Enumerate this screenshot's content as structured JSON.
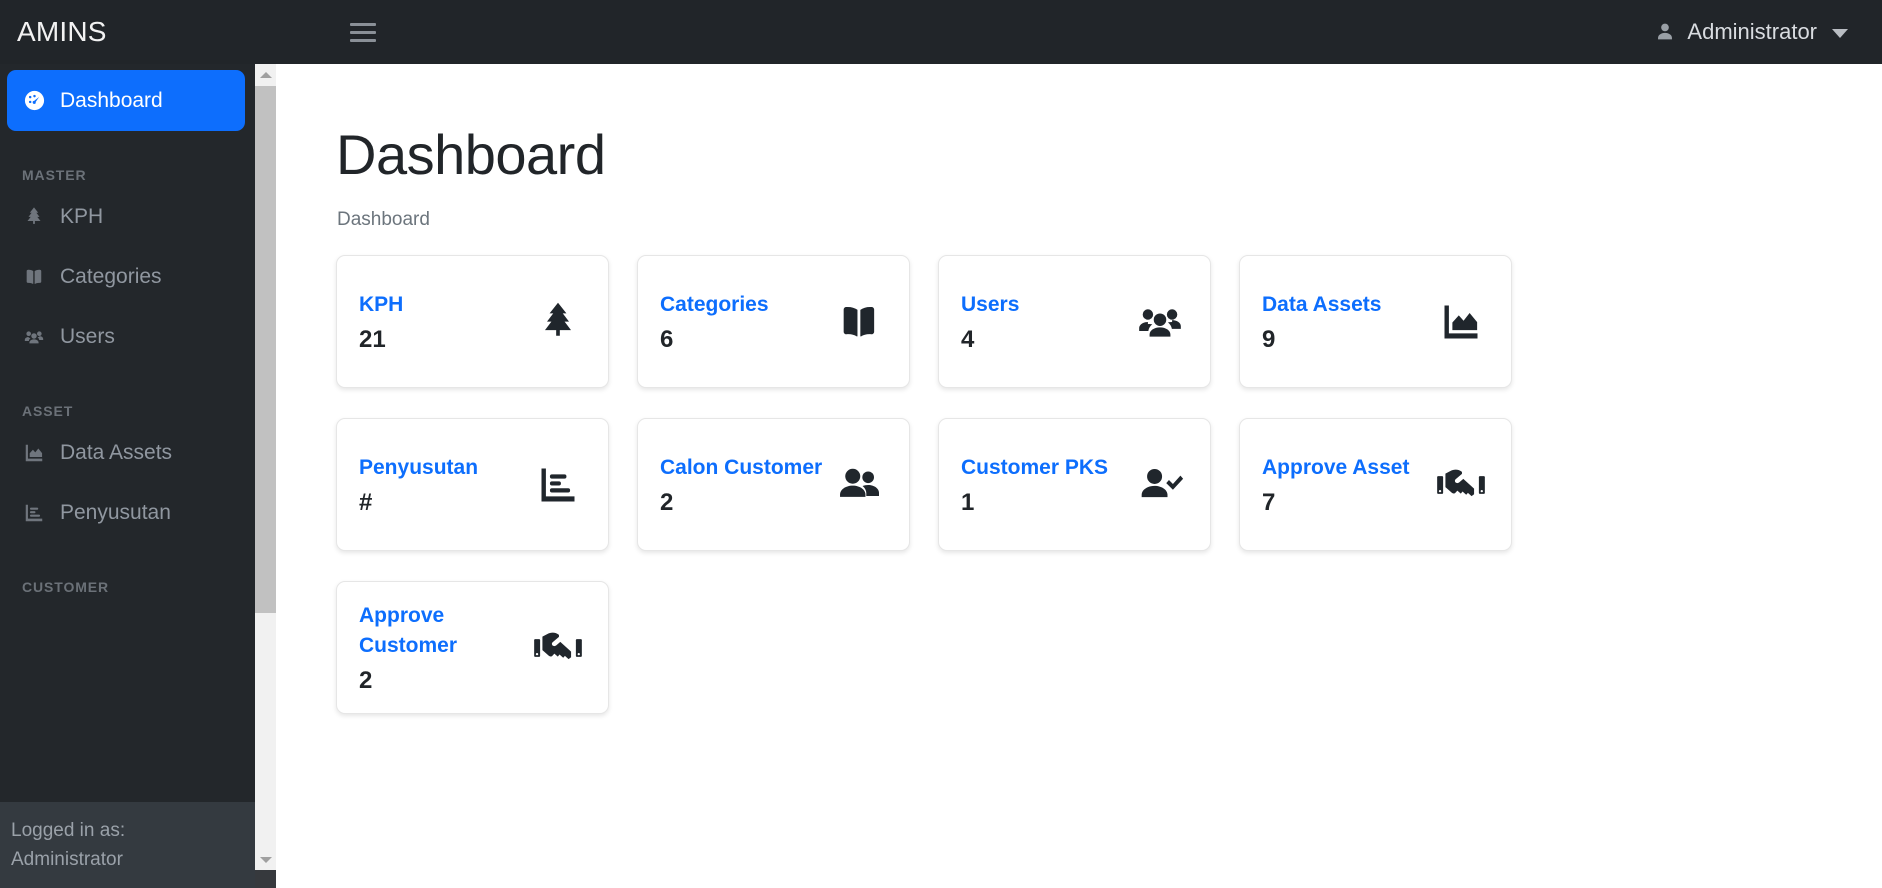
{
  "navbar": {
    "brand": "AMINS",
    "menu_toggle_label": "Toggle navigation",
    "user_name": "Administrator"
  },
  "sidebar": {
    "items": [
      {
        "label": "Dashboard",
        "icon": "dashboard-icon",
        "active": true
      },
      {
        "type": "header",
        "label": "MASTER"
      },
      {
        "label": "KPH",
        "icon": "tree-icon"
      },
      {
        "label": "Categories",
        "icon": "book-open-icon"
      },
      {
        "label": "Users",
        "icon": "users-icon"
      },
      {
        "type": "header",
        "label": "ASSET"
      },
      {
        "label": "Data Assets",
        "icon": "chart-area-icon"
      },
      {
        "label": "Penyusutan",
        "icon": "chart-bar-icon"
      },
      {
        "type": "header",
        "label": "CUSTOMER"
      }
    ],
    "footer": {
      "logged_in_label": "Logged in as:",
      "user_name": "Administrator"
    }
  },
  "main": {
    "title": "Dashboard",
    "breadcrumb": "Dashboard",
    "cards": [
      {
        "label": "KPH",
        "value": "21",
        "icon": "tree-icon"
      },
      {
        "label": "Categories",
        "value": "6",
        "icon": "book-open-icon"
      },
      {
        "label": "Users",
        "value": "4",
        "icon": "users-icon"
      },
      {
        "label": "Data Assets",
        "value": "9",
        "icon": "chart-area-icon"
      },
      {
        "label": "Penyusutan",
        "value": "#",
        "icon": "chart-bar-icon"
      },
      {
        "label": "Calon Customer",
        "value": "2",
        "icon": "user-friends-icon"
      },
      {
        "label": "Customer PKS",
        "value": "1",
        "icon": "user-check-icon"
      },
      {
        "label": "Approve Asset",
        "value": "7",
        "icon": "handshake-icon"
      },
      {
        "label": "Approve Customer",
        "value": "2",
        "icon": "handshake-icon"
      }
    ]
  },
  "colors": {
    "accent": "#0d6efd",
    "navbar_bg": "#212529",
    "sidebar_bg": "#23272b",
    "sidebar_footer_bg": "#343a40",
    "card_label": "#0d6efd",
    "icon_dark": "#20262c"
  },
  "scrollbar": {
    "position": "sidebar-right",
    "thumb_top_pct": 3,
    "thumb_height_pct": 64
  }
}
